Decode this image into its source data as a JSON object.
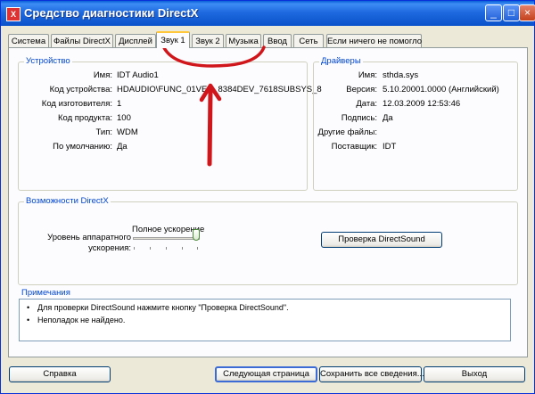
{
  "window": {
    "title": "Средство диагностики DirectX",
    "controls": [
      "_",
      "□",
      "×"
    ]
  },
  "tabs": [
    "Система",
    "Файлы DirectX",
    "Дисплей",
    "Звук 1",
    "Звук 2",
    "Музыка",
    "Ввод",
    "Сеть",
    "Если ничего не помогло"
  ],
  "active_tab": "Звук 1",
  "device": {
    "title": "Устройство",
    "rows": [
      {
        "label": "Имя:",
        "value": "IDT Audio1"
      },
      {
        "label": "Код устройства:",
        "value": "HDAUDIO\\FUNC_01VEN_8384DEV_7618SUBSYS_8"
      },
      {
        "label": "Код изготовителя:",
        "value": "1"
      },
      {
        "label": "Код продукта:",
        "value": "100"
      },
      {
        "label": "Тип:",
        "value": "WDM"
      },
      {
        "label": "По умолчанию:",
        "value": "Да"
      }
    ]
  },
  "drivers": {
    "title": "Драйверы",
    "rows": [
      {
        "label": "Имя:",
        "value": "sthda.sys"
      },
      {
        "label": "Версия:",
        "value": "5.10.20001.0000 (Английский)"
      },
      {
        "label": "Дата:",
        "value": "12.03.2009 12:53:46"
      },
      {
        "label": "Подпись:",
        "value": "Да"
      },
      {
        "label": "Другие файлы:",
        "value": ""
      },
      {
        "label": "Поставщик:",
        "value": "IDT"
      }
    ]
  },
  "directx": {
    "title": "Возможности DirectX",
    "accel_label_line1": "Уровень аппаратного",
    "accel_label_line2": "ускорения:",
    "accel_value": "Полное ускорение",
    "accel_level": 1.0,
    "test_button": "Проверка DirectSound"
  },
  "notes": {
    "title": "Примечания",
    "items": [
      "Для проверки DirectSound нажмите кнопку \"Проверка DirectSound\".",
      "Неполадок не найдено."
    ]
  },
  "buttons": {
    "help": "Справка",
    "next": "Следующая страница",
    "save": "Сохранить все сведения...",
    "exit": "Выход"
  },
  "annotation_color": "#d0161b"
}
